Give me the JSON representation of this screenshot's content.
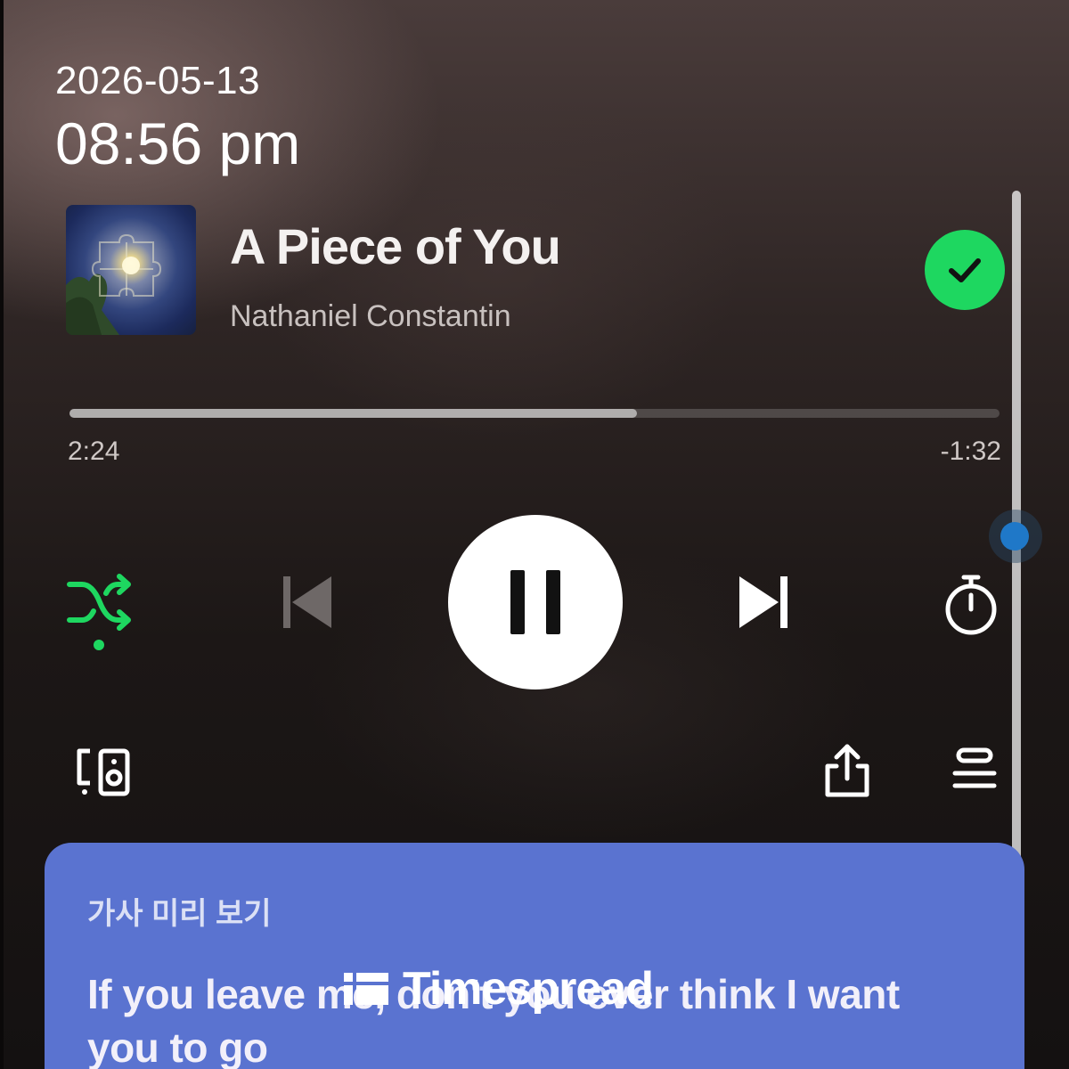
{
  "timestamp": {
    "date": "2026-05-13",
    "time": "08:56 pm"
  },
  "track": {
    "title": "A Piece of You",
    "artist": "Nathaniel Constantin"
  },
  "playback": {
    "elapsed": "2:24",
    "remaining": "-1:32",
    "progress_fraction": 0.61,
    "state": "playing"
  },
  "controls": {
    "saved_icon": "check-circle-icon",
    "shuffle_icon": "shuffle-icon",
    "previous_icon": "skip-previous-icon",
    "pause_icon": "pause-icon",
    "next_icon": "skip-next-icon",
    "timer_icon": "sleep-timer-icon",
    "devices_icon": "connect-device-icon",
    "share_icon": "share-icon",
    "queue_icon": "queue-icon"
  },
  "lyrics": {
    "label": "가사 미리 보기",
    "text": "If you leave me, don't you ever think I want you to go"
  },
  "watermark": {
    "text": "Timespread"
  },
  "colors": {
    "accent_green": "#1ed760",
    "lyrics_card": "#5a73d0",
    "scroll_knob": "#1f78c8"
  }
}
